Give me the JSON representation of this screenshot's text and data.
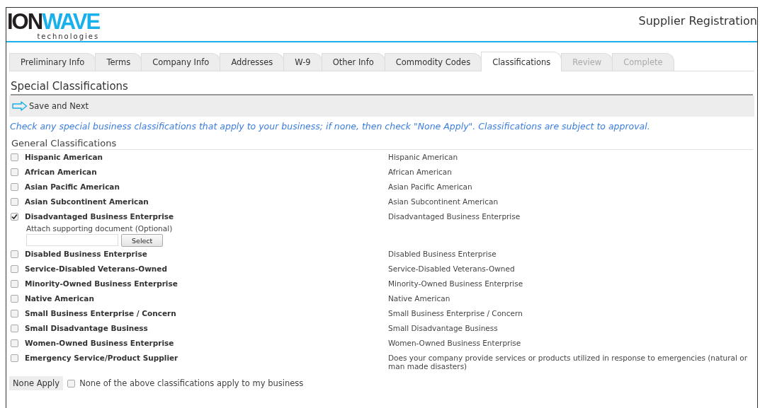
{
  "logo": {
    "dark": "ION",
    "accent": "WAVE",
    "tagline": "technologies"
  },
  "header": {
    "title": "Supplier Registration"
  },
  "tabs": [
    {
      "label": "Preliminary Info",
      "selected": false,
      "disabled": false
    },
    {
      "label": "Terms",
      "selected": false,
      "disabled": false
    },
    {
      "label": "Company Info",
      "selected": false,
      "disabled": false
    },
    {
      "label": "Addresses",
      "selected": false,
      "disabled": false
    },
    {
      "label": "W-9",
      "selected": false,
      "disabled": false
    },
    {
      "label": "Other Info",
      "selected": false,
      "disabled": false
    },
    {
      "label": "Commodity Codes",
      "selected": false,
      "disabled": false
    },
    {
      "label": "Classifications",
      "selected": true,
      "disabled": false
    },
    {
      "label": "Review",
      "selected": false,
      "disabled": true
    },
    {
      "label": "Complete",
      "selected": false,
      "disabled": true
    }
  ],
  "section_title": "Special Classifications",
  "toolbar": {
    "save_label": "Save and Next"
  },
  "instructions": "Check any special business classifications that apply to your business; if none, then check \"None Apply\". Classifications are subject to approval.",
  "group_title": "General Classifications",
  "classifications": [
    {
      "label": "Hispanic American",
      "description": "Hispanic American",
      "checked": false
    },
    {
      "label": "African American",
      "description": "African American",
      "checked": false
    },
    {
      "label": "Asian Pacific American",
      "description": "Asian Pacific American",
      "checked": false
    },
    {
      "label": "Asian Subcontinent American",
      "description": "Asian Subcontinent American",
      "checked": false
    },
    {
      "label": "Disadvantaged Business Enterprise",
      "description": "Disadvantaged Business Enterprise",
      "checked": true,
      "attachment": {
        "label": "Attach supporting document (Optional)",
        "button": "Select"
      }
    },
    {
      "label": "Disabled Business Enterprise",
      "description": "Disabled Business Enterprise",
      "checked": false
    },
    {
      "label": "Service-Disabled Veterans-Owned",
      "description": "Service-Disabled Veterans-Owned",
      "checked": false
    },
    {
      "label": "Minority-Owned Business Enterprise",
      "description": "Minority-Owned Business Enterprise",
      "checked": false
    },
    {
      "label": "Native American",
      "description": "Native American",
      "checked": false
    },
    {
      "label": "Small Business Enterprise / Concern",
      "description": "Small Business Enterprise / Concern",
      "checked": false
    },
    {
      "label": "Small Disadvantage Business",
      "description": "Small Disadvantage Business",
      "checked": false
    },
    {
      "label": "Women-Owned Business Enterprise",
      "description": "Women-Owned Business Enterprise",
      "checked": false
    },
    {
      "label": "Emergency Service/Product Supplier",
      "description": "Does your company provide services or products utilized in response to emergencies (natural or man made disasters)",
      "checked": false
    }
  ],
  "none_apply": {
    "button": "None Apply",
    "label": "None of the above classifications apply to my business",
    "checked": false
  }
}
